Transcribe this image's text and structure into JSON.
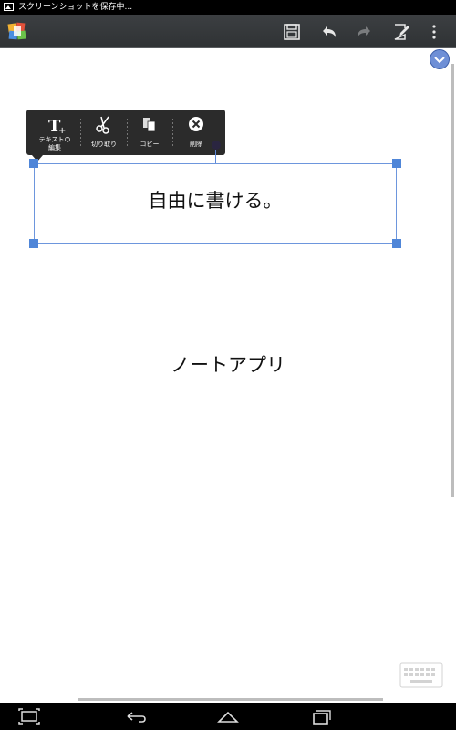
{
  "status_bar": {
    "text": "スクリーンショットを保存中..."
  },
  "action_bar": {
    "icons": [
      "save-icon",
      "undo-icon",
      "redo-icon",
      "edit-page-icon",
      "overflow-menu-icon"
    ]
  },
  "popup_toolbar": {
    "items": [
      {
        "label_line1": "テキストの",
        "label_line2": "編集",
        "icon": "text-edit-icon"
      },
      {
        "label": "切り取り",
        "icon": "scissors-icon"
      },
      {
        "label": "コピー",
        "icon": "copy-icon"
      },
      {
        "label": "削除",
        "icon": "delete-icon"
      }
    ]
  },
  "canvas": {
    "selected_text": "自由に書ける。",
    "note_text": "ノートアプリ"
  },
  "colors": {
    "selection": "#6d96dd",
    "handle": "#4f86d8",
    "action_bar": "#35383a"
  }
}
